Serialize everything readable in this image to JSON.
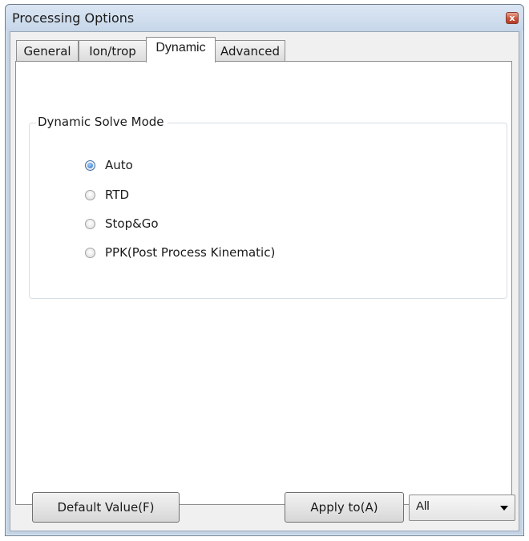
{
  "window": {
    "title": "Processing Options",
    "close_glyph": "x"
  },
  "tabs": [
    {
      "label": "General",
      "selected": false
    },
    {
      "label": "Ion/trop",
      "selected": false
    },
    {
      "label": "Dynamic",
      "selected": true
    },
    {
      "label": "Advanced",
      "selected": false
    }
  ],
  "group": {
    "title": "Dynamic Solve Mode",
    "options": [
      {
        "label": "Auto",
        "checked": true
      },
      {
        "label": "RTD",
        "checked": false
      },
      {
        "label": "Stop&Go",
        "checked": false
      },
      {
        "label": "PPK(Post Process Kinematic)",
        "checked": false
      }
    ]
  },
  "footer": {
    "default_button": "Default Value(F)",
    "apply_button": "Apply to(A)",
    "apply_target": "All"
  },
  "colors": {
    "title_bar": "#c7d7ea",
    "close_button": "#c9533a",
    "radio_accent": "#2a6fc0"
  },
  "icons": {
    "close": "close-icon",
    "dropdown": "chevron-down-icon"
  }
}
